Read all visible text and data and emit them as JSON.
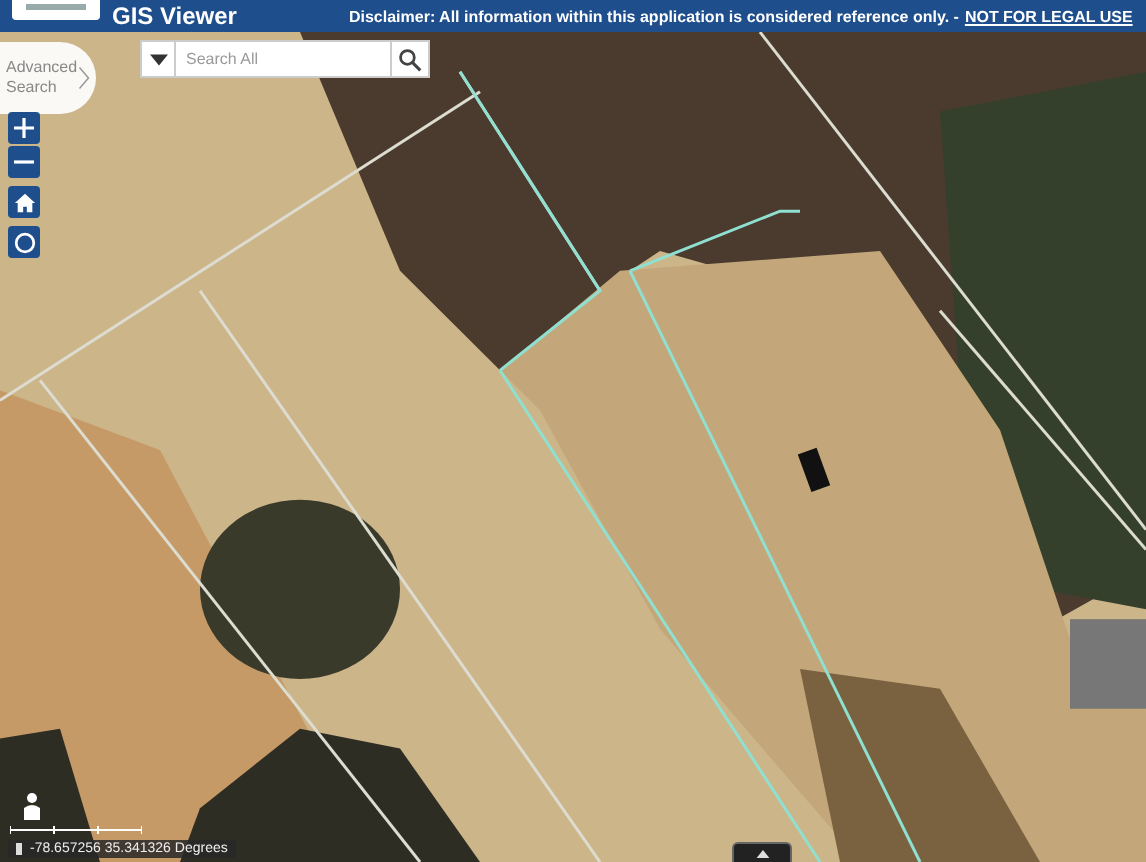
{
  "header": {
    "title": "GIS Viewer",
    "disclaimer": "Disclaimer: All information within this application is considered reference only. -",
    "disclaimer_link": "NOT FOR LEGAL USE"
  },
  "search": {
    "advanced_label": "Advanced Search",
    "placeholder": "Search All"
  },
  "status": {
    "coordinates": "-78.657256 35.341326 Degrees"
  }
}
